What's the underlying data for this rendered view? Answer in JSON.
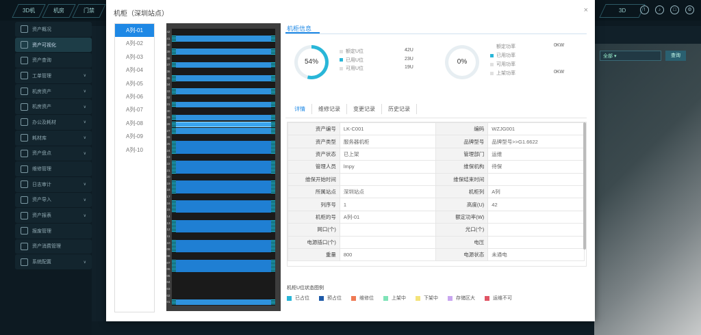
{
  "topnav": {
    "tabs": [
      "3D机",
      "机房",
      "门禁"
    ],
    "right_tabs": [
      "3D"
    ],
    "icons": [
      "info-icon",
      "volume-icon",
      "fullscreen-icon",
      "settings-icon"
    ]
  },
  "sidebar": {
    "items": [
      {
        "label": "资产概况",
        "expandable": false
      },
      {
        "label": "资产可视化",
        "expandable": false,
        "active": true
      },
      {
        "label": "资产查询",
        "expandable": false
      },
      {
        "label": "工单管理",
        "expandable": true
      },
      {
        "label": "机房资产",
        "expandable": true
      },
      {
        "label": "机房资产",
        "expandable": true
      },
      {
        "label": "办公及耗材",
        "expandable": true
      },
      {
        "label": "耗材库",
        "expandable": true
      },
      {
        "label": "资产盘点",
        "expandable": true
      },
      {
        "label": "维修管理",
        "expandable": false
      },
      {
        "label": "日志审计",
        "expandable": true
      },
      {
        "label": "资产导入",
        "expandable": true
      },
      {
        "label": "资产报表",
        "expandable": true
      },
      {
        "label": "报废管理",
        "expandable": false
      },
      {
        "label": "资产消费管理",
        "expandable": false
      },
      {
        "label": "系统配置",
        "expandable": true
      }
    ]
  },
  "background": {
    "select_value": "全部",
    "query_button": "查询"
  },
  "modal": {
    "title": "机柜（深圳站点）",
    "close": "×",
    "racks": [
      "A列-01",
      "A列-02",
      "A列-03",
      "A列-04",
      "A列-05",
      "A列-06",
      "A列-07",
      "A列-08",
      "A列-09",
      "A列-10"
    ],
    "selected_rack": "A列-01",
    "info_tab": "机柜信息",
    "space": {
      "percent_label": "54%",
      "percent": 0.54,
      "rows": [
        {
          "label": "额定U位",
          "value": "42U",
          "color": "#e0e0e0"
        },
        {
          "label": "已用U位",
          "value": "23U",
          "color": "#29b6d8"
        },
        {
          "label": "可用U位",
          "value": "19U",
          "color": "#e0e0e0"
        }
      ]
    },
    "power": {
      "percent_label": "0%",
      "percent": 0,
      "rows": [
        {
          "label": "额定功率",
          "value": "0KW",
          "color": "#ffffff"
        },
        {
          "label": "已用功率",
          "value": "",
          "color": "#29b6d8"
        },
        {
          "label": "可用功率",
          "value": "",
          "color": "#e0e0e0"
        },
        {
          "label": "上架功率",
          "value": "0KW",
          "color": "#e0e0e0"
        }
      ]
    },
    "subtabs": [
      "详情",
      "维修记录",
      "变更记录",
      "历史记录"
    ],
    "details": [
      [
        "资产编号",
        "LK-C001",
        "编码",
        "WZJG001"
      ],
      [
        "资产类型",
        "服务器机柜",
        "品牌型号",
        "品牌型号>>G1.6622"
      ],
      [
        "资产状态",
        "已上架",
        "管理部门",
        "运维"
      ],
      [
        "管理人员",
        "lmpy",
        "维保机构",
        "待保"
      ],
      [
        "维保开始时间",
        "",
        "维保结束时间",
        ""
      ],
      [
        "所属站点",
        "深圳站点",
        "机柜列",
        "A列"
      ],
      [
        "列序号",
        "1",
        "高度(U)",
        "42"
      ],
      [
        "机柜的号",
        "A列-01",
        "额定功率(W)",
        ""
      ],
      [
        "网口(个)",
        "",
        "光口(个)",
        ""
      ],
      [
        "电源插口(个)",
        "",
        "电压",
        ""
      ],
      [
        "重量",
        "800",
        "电源状态",
        "未通电"
      ]
    ],
    "status_title": "机柜U位状态图例",
    "status_legend": [
      {
        "label": "已占位",
        "color": "#29b6d8"
      },
      {
        "label": "预占位",
        "color": "#1e5aa8"
      },
      {
        "label": "维修位",
        "color": "#ef7a54"
      },
      {
        "label": "上架中",
        "color": "#7fe3b8"
      },
      {
        "label": "下架中",
        "color": "#f4e37a"
      },
      {
        "label": "存储区大",
        "color": "#c9a6f0"
      },
      {
        "label": "运维不可",
        "color": "#e05565"
      }
    ]
  }
}
